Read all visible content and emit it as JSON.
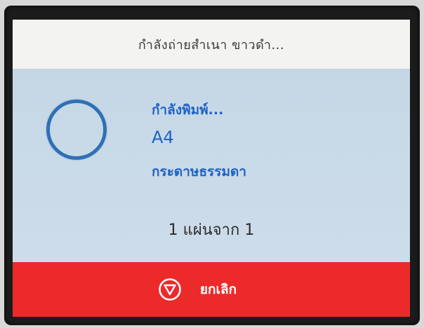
{
  "header": {
    "title": "กำลังถ่ายสำเนา ขาวดำ..."
  },
  "job": {
    "status": "กำลังพิมพ์...",
    "paper_size": "A4",
    "paper_type": "กระดาษธรรมดา",
    "page_count": "1 แผ่นจาก 1"
  },
  "footer": {
    "cancel_label": "ยกเลิก",
    "cancel_icon": "stop-icon"
  },
  "colors": {
    "header_bg": "#f3f3f1",
    "main_bg": "#cadbe8",
    "accent_blue": "#1f62c4",
    "cancel_red": "#ec2a2a"
  }
}
